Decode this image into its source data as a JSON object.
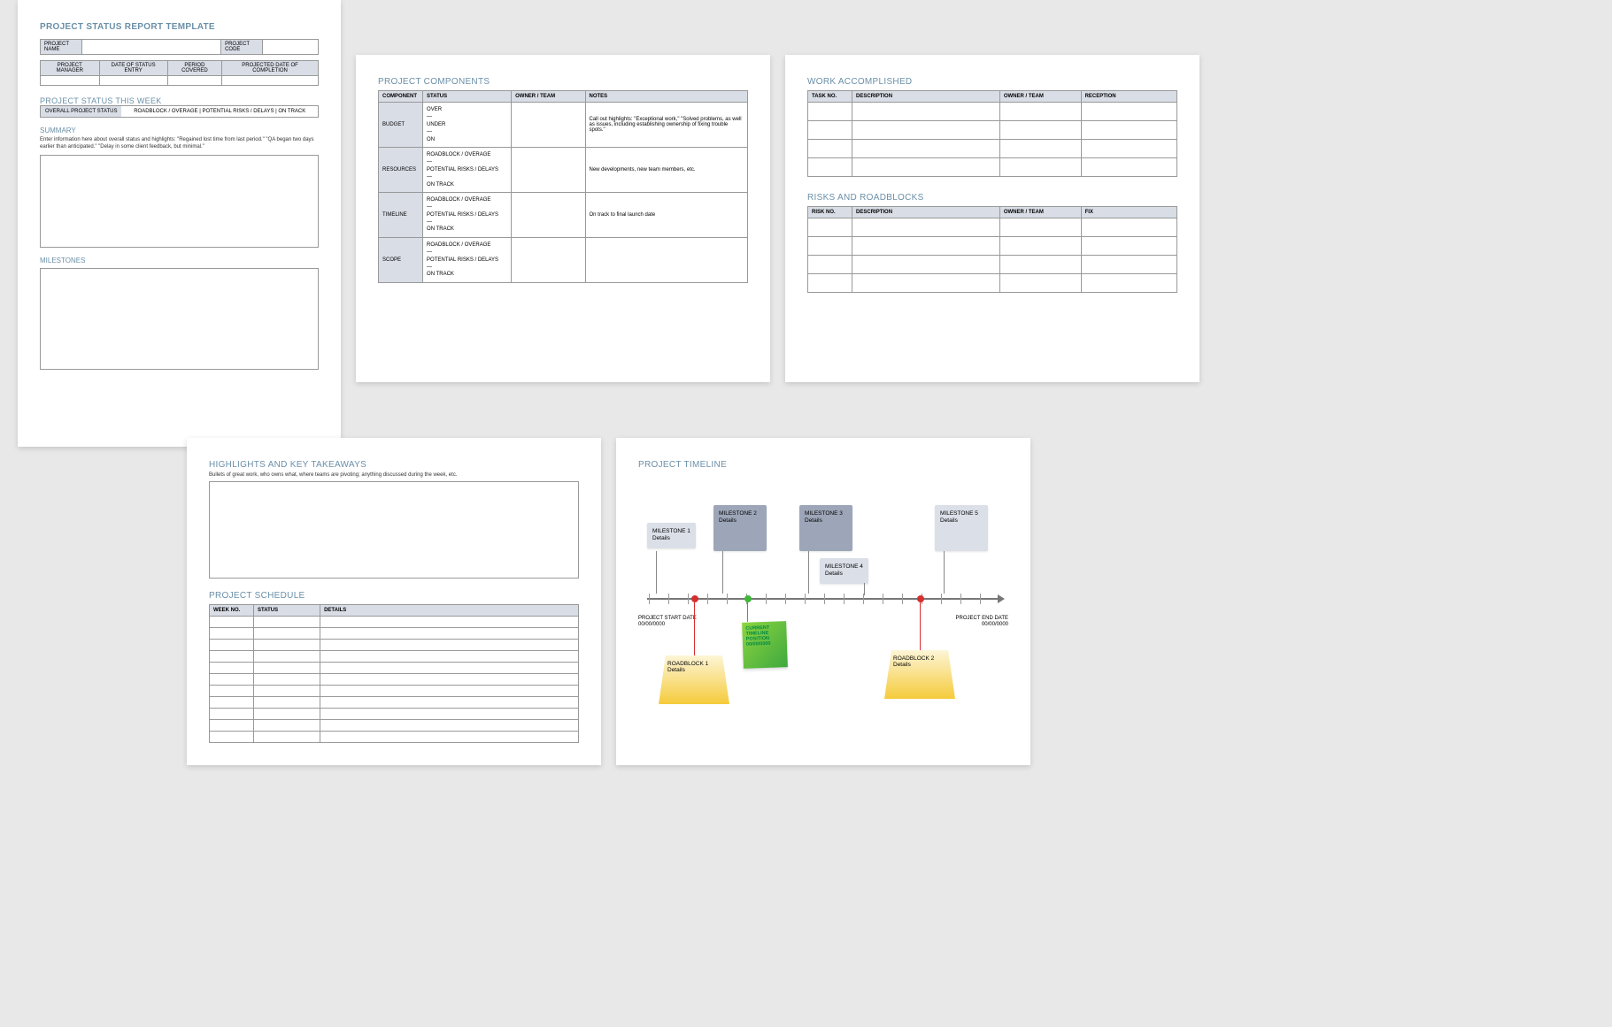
{
  "page1": {
    "title": "PROJECT STATUS REPORT TEMPLATE",
    "meta": {
      "project_name_label": "PROJECT NAME",
      "project_code_label": "PROJECT CODE",
      "cols": [
        "PROJECT MANAGER",
        "DATE OF STATUS ENTRY",
        "PERIOD COVERED",
        "PROJECTED DATE OF COMPLETION"
      ]
    },
    "status_week_title": "PROJECT STATUS THIS WEEK",
    "overall_label": "OVERALL PROJECT STATUS",
    "overall_opts": "ROADBLOCK / OVERAGE    |    POTENTIAL RISKS / DELAYS    |    ON TRACK",
    "summary_title": "SUMMARY",
    "summary_text": "Enter information here about overall status and highlights: \"Regained lost time from last period.\" \"QA began two days earlier than anticipated.\" \"Delay in some client feedback, but minimal.\"",
    "milestones_title": "MILESTONES"
  },
  "page2": {
    "title": "PROJECT COMPONENTS",
    "headers": [
      "COMPONENT",
      "STATUS",
      "OWNER / TEAM",
      "NOTES"
    ],
    "rows": [
      {
        "component": "BUDGET",
        "status": [
          "OVER",
          "—",
          "UNDER",
          "—",
          "ON"
        ],
        "notes": "Call out highlights: \"Exceptional work,\" \"Solved problems, as well as issues, including establishing ownership of fixing trouble spots.\""
      },
      {
        "component": "RESOURCES",
        "status": [
          "ROADBLOCK / OVERAGE",
          "—",
          "POTENTIAL RISKS / DELAYS",
          "—",
          "ON TRACK"
        ],
        "notes": "New developments, new team members, etc."
      },
      {
        "component": "TIMELINE",
        "status": [
          "ROADBLOCK / OVERAGE",
          "—",
          "POTENTIAL RISKS / DELAYS",
          "—",
          "ON TRACK"
        ],
        "notes": "On track to final launch date"
      },
      {
        "component": "SCOPE",
        "status": [
          "ROADBLOCK / OVERAGE",
          "—",
          "POTENTIAL RISKS / DELAYS",
          "—",
          "ON TRACK"
        ],
        "notes": ""
      }
    ]
  },
  "page3": {
    "work_title": "WORK ACCOMPLISHED",
    "work_headers": [
      "TASK NO.",
      "DESCRIPTION",
      "OWNER / TEAM",
      "RECEPTION"
    ],
    "risks_title": "RISKS AND ROADBLOCKS",
    "risks_headers": [
      "RISK NO.",
      "DESCRIPTION",
      "OWNER / TEAM",
      "FIX"
    ]
  },
  "page4": {
    "highlights_title": "HIGHLIGHTS AND KEY TAKEAWAYS",
    "highlights_note": "Bullets of great work, who owns what, where teams are pivoting; anything discussed during the week, etc.",
    "schedule_title": "PROJECT SCHEDULE",
    "schedule_headers": [
      "WEEK NO.",
      "STATUS",
      "DETAILS"
    ]
  },
  "page5": {
    "title": "PROJECT TIMELINE",
    "milestones": [
      {
        "label": "MILESTONE 1",
        "sub": "Details"
      },
      {
        "label": "MILESTONE 2",
        "sub": "Details"
      },
      {
        "label": "MILESTONE 3",
        "sub": "Details"
      },
      {
        "label": "MILESTONE 4",
        "sub": "Details"
      },
      {
        "label": "MILESTONE 5",
        "sub": "Details"
      }
    ],
    "start_label": "PROJECT START DATE",
    "start_date": "00/00/0000",
    "end_label": "PROJECT END DATE",
    "end_date": "00/00/0000",
    "current_label": "CURRENT TIMELINE POSITION",
    "current_date": "00/00/0000",
    "roadblocks": [
      {
        "label": "ROADBLOCK 1",
        "sub": "Details"
      },
      {
        "label": "ROADBLOCK 2",
        "sub": "Details"
      }
    ]
  }
}
